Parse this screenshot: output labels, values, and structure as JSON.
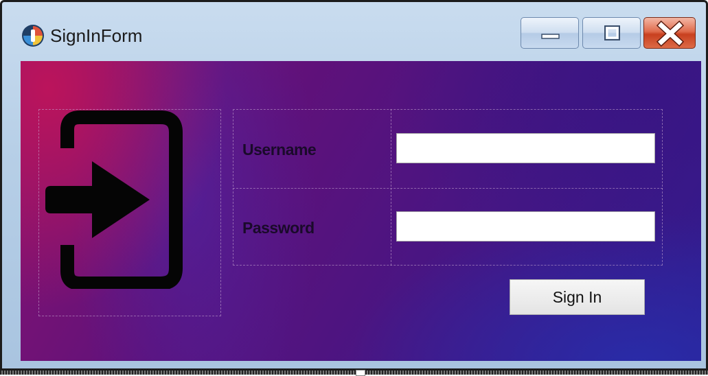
{
  "window": {
    "title": "SignInForm",
    "app_icon": "app-logo-icon",
    "controls": {
      "minimize_icon": "minimize-icon",
      "maximize_icon": "maximize-icon",
      "close_icon": "close-icon"
    }
  },
  "form": {
    "illustration_icon": "sign-in-icon",
    "username_label": "Username",
    "username_value": "",
    "password_label": "Password",
    "password_value": "",
    "signin_label": "Sign In"
  },
  "colors": {
    "gradient_start": "#8a1470",
    "gradient_end": "#2f1c8f",
    "close_button": "#c8401f"
  }
}
